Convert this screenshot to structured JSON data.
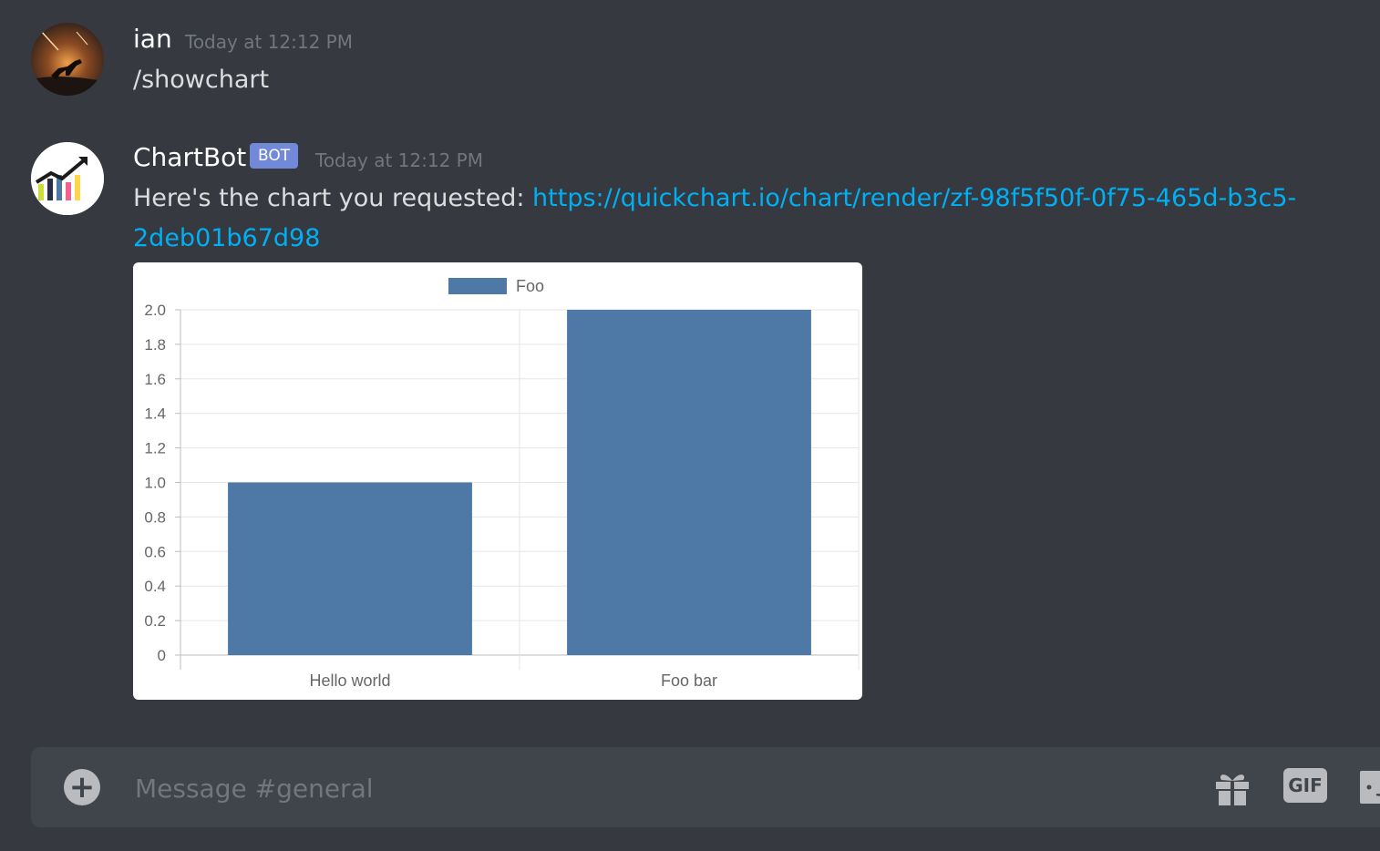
{
  "messages": [
    {
      "author": "ian",
      "timestamp": "Today at 12:12 PM",
      "text": "/showchart"
    },
    {
      "author": "ChartBot",
      "badge": "BOT",
      "timestamp": "Today at 12:12 PM",
      "text": "Here's the chart you requested: ",
      "link_line1": "https://quickchart.io/chart/render/zf-98f5f50f-0f75-465d-b3c5-",
      "link_line2": "2deb01b67d98"
    }
  ],
  "composer": {
    "placeholder": "Message #general",
    "gif_label": "GIF",
    "plus_label": "+"
  },
  "colors": {
    "background": "#36393f",
    "accent_link": "#00b0f4",
    "bot_badge": "#7289da",
    "bar": "#4e79a7"
  },
  "chart_data": {
    "type": "bar",
    "categories": [
      "Hello world",
      "Foo bar"
    ],
    "series": [
      {
        "name": "Foo",
        "values": [
          1,
          2
        ]
      }
    ],
    "ylim": [
      0,
      2
    ],
    "yticks": [
      "0",
      "0.2",
      "0.4",
      "0.6",
      "0.8",
      "1.0",
      "1.2",
      "1.4",
      "1.6",
      "1.8",
      "2.0"
    ],
    "grid": true,
    "legend": "top"
  }
}
